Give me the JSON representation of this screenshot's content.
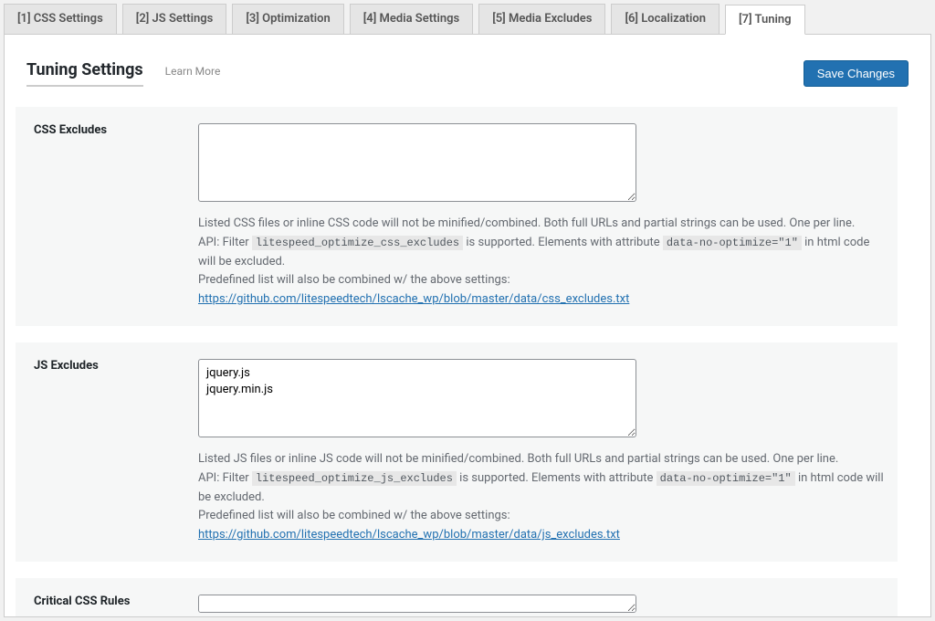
{
  "tabs": [
    {
      "label": "[1] CSS Settings"
    },
    {
      "label": "[2] JS Settings"
    },
    {
      "label": "[3] Optimization"
    },
    {
      "label": "[4] Media Settings"
    },
    {
      "label": "[5] Media Excludes"
    },
    {
      "label": "[6] Localization"
    },
    {
      "label": "[7] Tuning"
    }
  ],
  "activeTab": 6,
  "pageTitle": "Tuning Settings",
  "learnMore": "Learn More",
  "saveButton": "Save Changes",
  "rows": {
    "cssExcludes": {
      "label": "CSS Excludes",
      "value": "",
      "desc1": "Listed CSS files or inline CSS code will not be minified/combined. Both full URLs and partial strings can be used. One per line.",
      "apiPrefix": "API: Filter",
      "apiFilter": "litespeed_optimize_css_excludes",
      "apiMiddle": "is supported. Elements with attribute",
      "apiAttr": "data-no-optimize=\"1\"",
      "apiSuffix": "in html code will be excluded.",
      "predef": "Predefined list will also be combined w/ the above settings:",
      "link": "https://github.com/litespeedtech/lscache_wp/blob/master/data/css_excludes.txt"
    },
    "jsExcludes": {
      "label": "JS Excludes",
      "value": "jquery.js\njquery.min.js",
      "desc1": "Listed JS files or inline JS code will not be minified/combined. Both full URLs and partial strings can be used. One per line.",
      "apiPrefix": "API: Filter",
      "apiFilter": "litespeed_optimize_js_excludes",
      "apiMiddle": "is supported. Elements with attribute",
      "apiAttr": "data-no-optimize=\"1\"",
      "apiSuffix": "in html code will be excluded.",
      "predef": "Predefined list will also be combined w/ the above settings:",
      "link": "https://github.com/litespeedtech/lscache_wp/blob/master/data/js_excludes.txt"
    },
    "criticalCss": {
      "label": "Critical CSS Rules",
      "value": ""
    }
  }
}
